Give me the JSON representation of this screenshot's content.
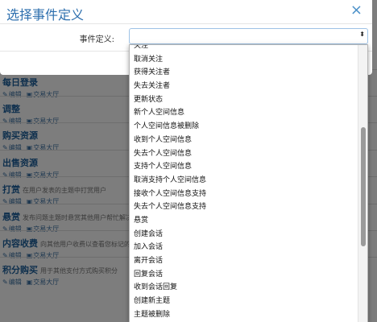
{
  "modal": {
    "title": "选择事件定义",
    "close_glyph": "×",
    "field_label": "事件定义:",
    "select_value": "",
    "select_arrow": "⬍"
  },
  "dropdown": {
    "options": [
      "关注",
      "取消关注",
      "获得关注者",
      "失去关注者",
      "更新状态",
      "新个人空间信息",
      "个人空间信息被删除",
      "收到个人空间信息",
      "失去个人空间信息",
      "支持个人空间信息",
      "取消支持个人空间信息",
      "接收个人空间信息支持",
      "失去个人空间信息支持",
      "悬赏",
      "创建会话",
      "加入会话",
      "离开会话",
      "回复会话",
      "收到会话回复",
      "创建新主题",
      "主题被删除"
    ]
  },
  "background": {
    "edit_icon": "✎",
    "market_icon": "▣",
    "rows": [
      {
        "title": "每日登录",
        "desc": "",
        "edit": "编辑",
        "market": "交易大厅"
      },
      {
        "title": "调整",
        "desc": "",
        "edit": "编辑",
        "market": "交易大厅"
      },
      {
        "title": "购买资源",
        "desc": "",
        "edit": "编辑",
        "market": "交易大厅"
      },
      {
        "title": "出售资源",
        "desc": "",
        "edit": "编辑",
        "market": "交易大厅"
      },
      {
        "title": "打赏",
        "desc": "在用户发表的主题中打赏用户",
        "edit": "编辑",
        "market": "交易大厅"
      },
      {
        "title": "悬赏",
        "desc": "发布问题主题时悬赏其他用户帮忙解决问题",
        "edit": "编辑",
        "market": "交易大厅"
      },
      {
        "title": "内容收费",
        "desc": "向其他用户收费以查看您标记的收费内容",
        "edit": "编辑",
        "market": "交易大厅"
      },
      {
        "title": "积分购买",
        "desc": "用于其他支付方式购买积分",
        "edit": "编辑",
        "market": "交易大厅"
      }
    ]
  }
}
